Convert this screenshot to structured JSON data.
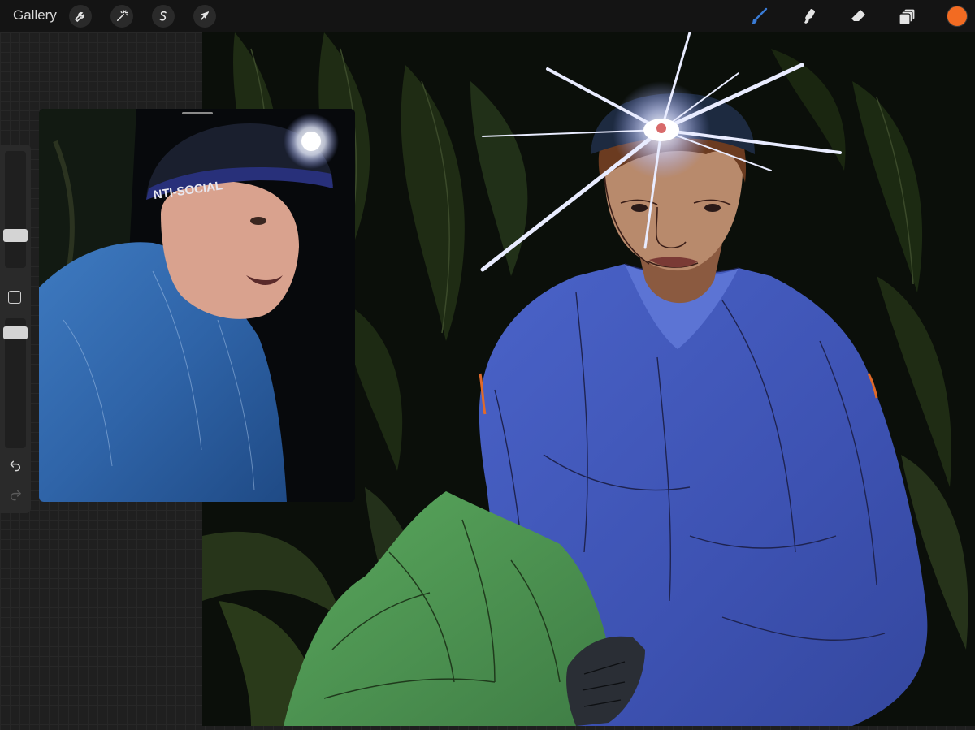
{
  "app": {
    "gallery_label": "Gallery"
  },
  "toolbar": {
    "left_icons": [
      "wrench-icon",
      "magic-wand-icon",
      "selection-icon",
      "transform-arrow-icon"
    ],
    "right_tools": [
      "brush-icon",
      "smudge-icon",
      "eraser-icon",
      "layers-icon"
    ],
    "active_tool": "brush",
    "current_color": "#f26b22"
  },
  "sidebar": {
    "brush_size_slider": "brush-size",
    "opacity_slider": "opacity",
    "modify_button": "square-modify",
    "undo_icon": "undo-icon",
    "redo_icon": "redo-icon"
  },
  "reference": {
    "beanie_text": "NTI-SOCIAL"
  },
  "colors": {
    "accent_brush": "#3a7bd5",
    "jacket": "#3e57b8",
    "bag": "#4f9a52",
    "background": "#0d130c"
  }
}
